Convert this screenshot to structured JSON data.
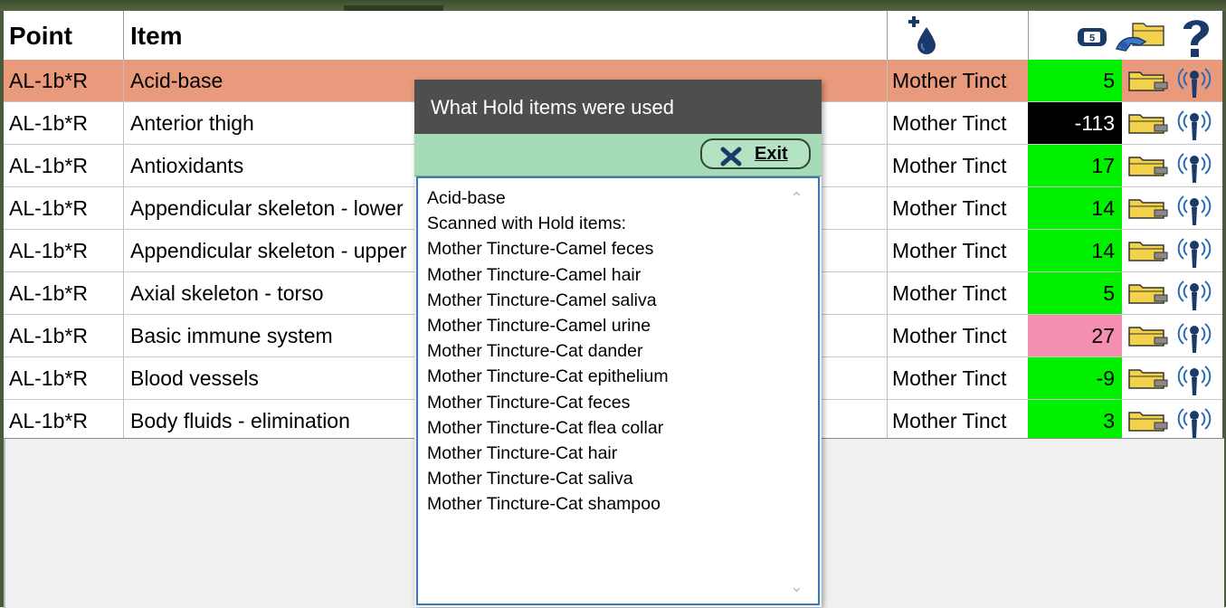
{
  "table": {
    "headers": {
      "point": "Point",
      "item": "Item"
    },
    "header_icons": [
      "tincture-drop-icon",
      "five-badge-icon",
      "folder-hand-icon",
      "help-icon"
    ],
    "rows": [
      {
        "point": "AL-1b*R",
        "item": "Acid-base",
        "hold": "Mother Tinct",
        "value": "5",
        "status": "green",
        "selected": true
      },
      {
        "point": "AL-1b*R",
        "item": "Anterior thigh",
        "hold": "Mother Tinct",
        "value": "-113",
        "status": "black",
        "selected": false
      },
      {
        "point": "AL-1b*R",
        "item": "Antioxidants",
        "hold": "Mother Tinct",
        "value": "17",
        "status": "green",
        "selected": false
      },
      {
        "point": "AL-1b*R",
        "item": "Appendicular skeleton - lower",
        "hold": "Mother Tinct",
        "value": "14",
        "status": "green",
        "selected": false
      },
      {
        "point": "AL-1b*R",
        "item": "Appendicular skeleton - upper",
        "hold": "Mother Tinct",
        "value": "14",
        "status": "green",
        "selected": false
      },
      {
        "point": "AL-1b*R",
        "item": "Axial skeleton - torso",
        "hold": "Mother Tinct",
        "value": "5",
        "status": "green",
        "selected": false
      },
      {
        "point": "AL-1b*R",
        "item": "Basic immune system",
        "hold": "Mother Tinct",
        "value": "27",
        "status": "pink",
        "selected": false
      },
      {
        "point": "AL-1b*R",
        "item": "Blood vessels",
        "hold": "Mother Tinct",
        "value": "-9",
        "status": "green",
        "selected": false
      },
      {
        "point": "AL-1b*R",
        "item": "Body fluids - elimination",
        "hold": "Mother Tinct",
        "value": "3",
        "status": "green",
        "selected": false
      }
    ]
  },
  "status_colors": {
    "green": "#00f000",
    "black": "#000000",
    "pink": "#f48fb0",
    "selected_row": "#e99a7c"
  },
  "dialog": {
    "title": "What Hold items were used",
    "exit_label": "Exit",
    "lines": [
      "Acid-base",
      "Scanned with Hold items:",
      "Mother Tincture-Camel feces",
      "Mother Tincture-Camel hair",
      "Mother Tincture-Camel saliva",
      "Mother Tincture-Camel urine",
      "Mother Tincture-Cat dander",
      "Mother Tincture-Cat epithelium",
      "Mother Tincture-Cat feces",
      "Mother Tincture-Cat flea collar",
      "Mother Tincture-Cat hair",
      "Mother Tincture-Cat saliva",
      "Mother Tincture-Cat shampoo"
    ]
  }
}
